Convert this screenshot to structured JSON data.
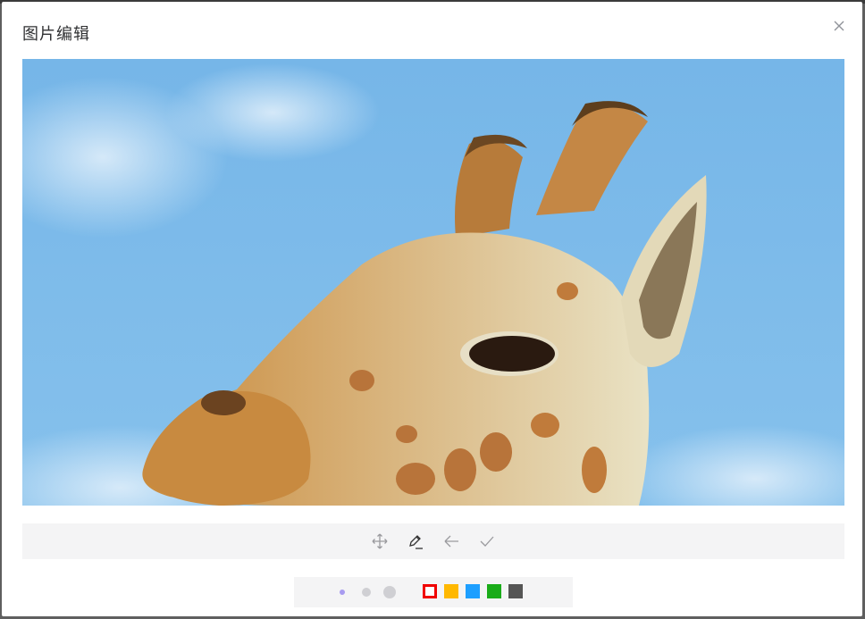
{
  "dialog": {
    "title": "图片编辑",
    "close_icon": "close-icon"
  },
  "toolbar": {
    "tools": [
      {
        "name": "move",
        "icon": "move-arrows-icon",
        "active": false
      },
      {
        "name": "draw",
        "icon": "pencil-icon",
        "active": true
      },
      {
        "name": "undo",
        "icon": "arrow-left-icon",
        "active": false
      },
      {
        "name": "confirm",
        "icon": "check-icon",
        "active": false
      }
    ]
  },
  "palette": {
    "brush_sizes": [
      "small",
      "medium",
      "large"
    ],
    "selected_brush_size": "small",
    "colors": [
      "#f00000",
      "#ffb800",
      "#1e9fff",
      "#1aac19",
      "#555555"
    ],
    "selected_color": "#f00000"
  }
}
